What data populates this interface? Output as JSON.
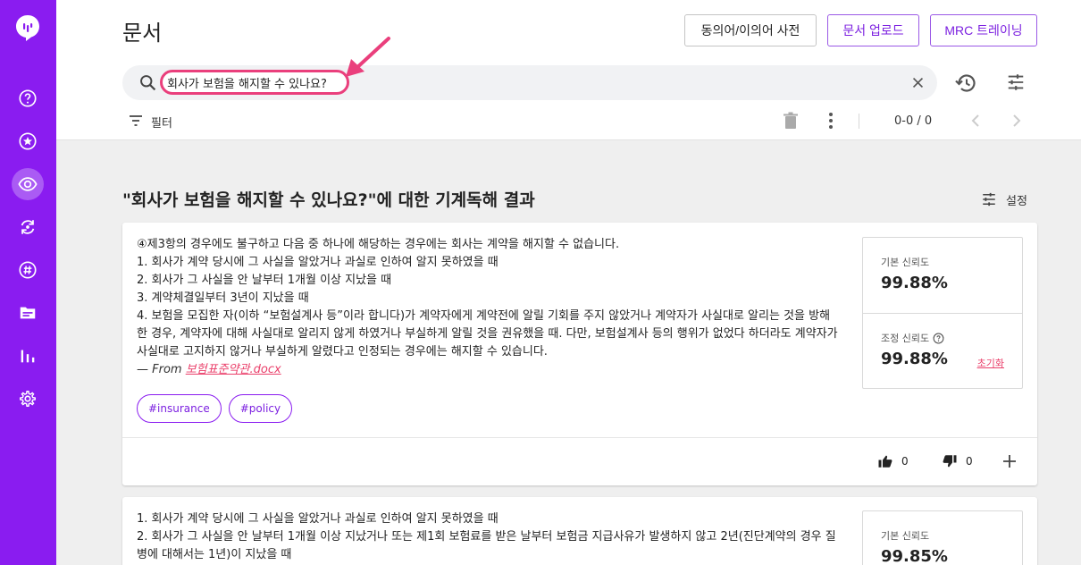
{
  "sidebar": {
    "items": [
      {
        "name": "help-circle-icon"
      },
      {
        "name": "star-badge-icon"
      },
      {
        "name": "eye-icon",
        "active": true
      },
      {
        "name": "sync-icon"
      },
      {
        "name": "hashtag-icon"
      },
      {
        "name": "folder-icon"
      },
      {
        "name": "bar-chart-icon"
      },
      {
        "name": "gear-icon"
      }
    ]
  },
  "header": {
    "title": "문서",
    "buttons": {
      "dictionary": "동의어/이의어 사전",
      "upload": "문서 업로드",
      "mrc_training": "MRC 트레이닝"
    }
  },
  "search": {
    "value": "회사가 보험을 해지할 수 있나요?"
  },
  "toolbar": {
    "filter_label": "필터",
    "page_count": "0-0 / 0"
  },
  "results": {
    "title": "\"회사가 보험을 해지할 수 있나요?\"에 대한 기계독해 결과",
    "settings_label": "설정",
    "cards": [
      {
        "lines": [
          "④제3항의 경우에도 불구하고 다음 중 하나에 해당하는 경우에는 회사는 계약을 해지할 수 없습니다.",
          "1. 회사가 계약 당시에 그 사실을 알았거나 과실로 인하여 알지 못하였을 때",
          "2. 회사가 그 사실을 안 날부터 1개월 이상 지났을 때",
          "3. 계약체결일부터 3년이 지났을 때",
          "4. 보험을 모집한 자(이하 “보험설계사 등”이라 합니다)가 계약자에게 계약전에 알릴 기회를 주지 않았거나 계약자가 사실대로 알리는 것을 방해한 경우, 계약자에 대해 사실대로 알리지 않게 하였거나 부실하게 알릴 것을 권유했을 때. 다만, 보험설계사 등의 행위가 없었다 하더라도 계약자가 사실대로 고지하지 않거나 부실하게 알렸다고 인정되는 경우에는 해지할 수 있습니다."
        ],
        "from_prefix": "— From ",
        "source_file": "보험표준약관.docx",
        "tags": [
          "#insurance",
          "#policy"
        ],
        "base_confidence_label": "기본 신뢰도",
        "base_confidence": "99.88%",
        "adjusted_confidence_label": "조정 신뢰도",
        "adjusted_confidence": "99.88%",
        "reset_label": "초기화",
        "likes": "0",
        "dislikes": "0"
      },
      {
        "lines": [
          "1. 회사가 계약 당시에 그 사실을 알았거나 과실로 인하여 알지 못하였을 때",
          "2. 회사가 그 사실을 안 날부터 1개월 이상 지났거나 또는 제1회 보험료를 받은 날부터 보험금 지급사유가 발생하지 않고 2년(진단계약의 경우 질병에 대해서는 1년)이 지났을 때"
        ],
        "base_confidence_label": "기본 신뢰도",
        "base_confidence": "99.85%"
      }
    ]
  },
  "colors": {
    "sidebar": "#8a1cf0",
    "accent": "#7b1fe0",
    "highlight": "#ea3f7c"
  }
}
